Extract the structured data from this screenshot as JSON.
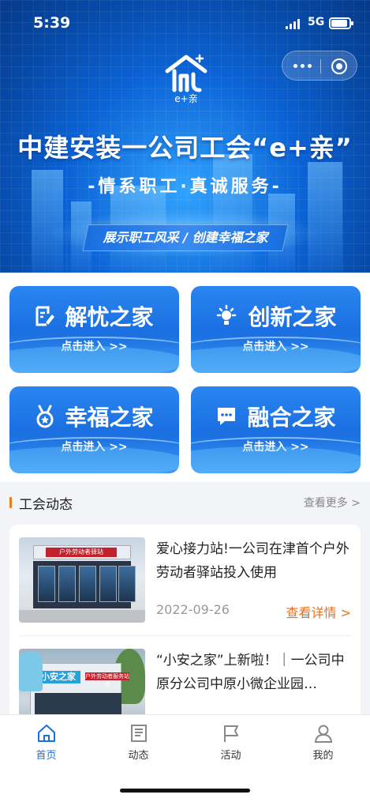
{
  "status_bar": {
    "time": "5:39",
    "network": "5G"
  },
  "banner": {
    "logo_text": "e+亲",
    "title": "中建安装一公司工会“e+亲”",
    "subtitle": "-情系职工·真诚服务-",
    "slogan": "展示职工风采 / 创建幸福之家"
  },
  "cards": [
    {
      "title": "解忧之家",
      "enter": "点击进入 >>",
      "icon": "edit-document-icon"
    },
    {
      "title": "创新之家",
      "enter": "点击进入 >>",
      "icon": "lightbulb-icon"
    },
    {
      "title": "幸福之家",
      "enter": "点击进入 >>",
      "icon": "medal-icon"
    },
    {
      "title": "融合之家",
      "enter": "点击进入 >>",
      "icon": "chat-bubble-icon"
    }
  ],
  "news": {
    "section_title": "工会动态",
    "more_label": "查看更多 >",
    "items": [
      {
        "title": "爱心接力站!一公司在津首个户外劳动者驿站投入使用",
        "date": "2022-09-26",
        "detail_label": "查看详情 >",
        "thumb_sign": "户外劳动者驿站"
      },
      {
        "title": "“小安之家”上新啦！｜一公司中原分公司中原小微企业园…",
        "thumb_sign": "小安之家",
        "thumb_sign2": "户外劳动者服务站点"
      }
    ]
  },
  "tabbar": {
    "items": [
      {
        "label": "首页",
        "icon": "home-icon",
        "active": true
      },
      {
        "label": "动态",
        "icon": "news-icon",
        "active": false
      },
      {
        "label": "活动",
        "icon": "flag-icon",
        "active": false
      },
      {
        "label": "我的",
        "icon": "user-icon",
        "active": false
      }
    ]
  },
  "colors": {
    "primary": "#1a6fd8",
    "accent_orange": "#e8701a",
    "banner_blue": "#0b63d6"
  }
}
